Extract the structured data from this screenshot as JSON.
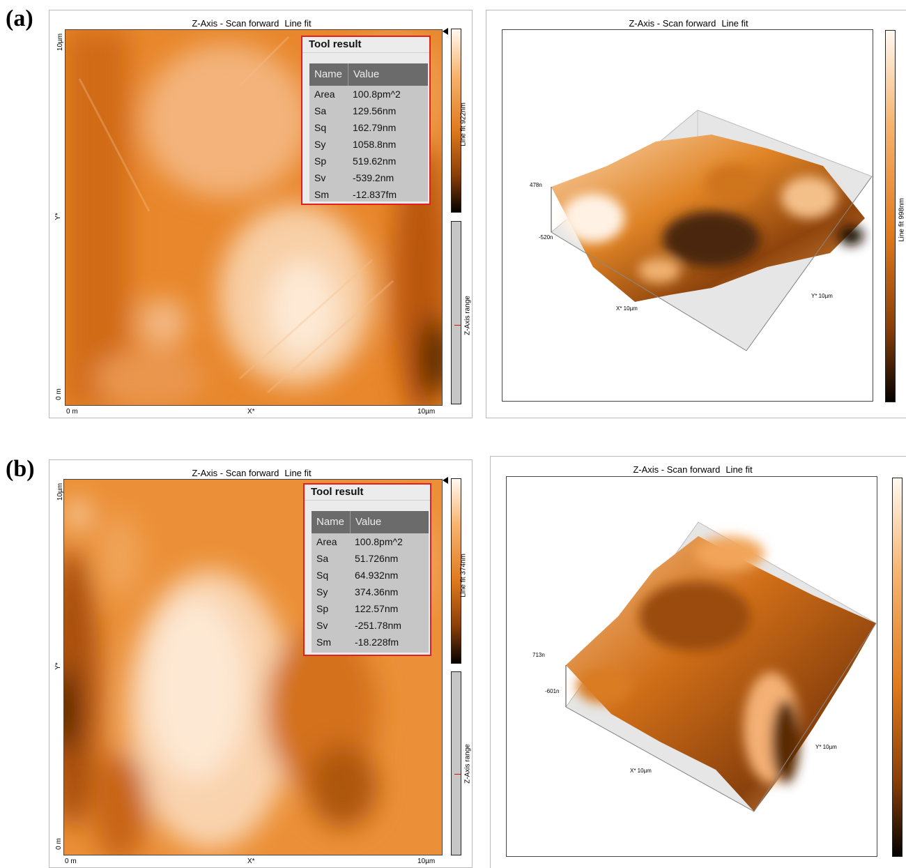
{
  "panels": [
    {
      "label": "(a)",
      "afm2d": {
        "title_main": "Z-Axis - Scan forward",
        "title_fit": "Line fit",
        "y_top": "10µm",
        "y_mid": "Y*",
        "y_bottom": "0 m",
        "x_left": "0 m",
        "x_mid": "X*",
        "x_right": "10µm",
        "colorbar_label": "Line fit 922nm",
        "range_label": "Z-Axis range"
      },
      "tool": {
        "title": "Tool result",
        "headers": [
          "Name",
          "Value"
        ],
        "rows": [
          [
            "Area",
            "100.8pm^2"
          ],
          [
            "Sa",
            "129.56nm"
          ],
          [
            "Sq",
            "162.79nm"
          ],
          [
            "Sy",
            "1058.8nm"
          ],
          [
            "Sp",
            "519.62nm"
          ],
          [
            "Sv",
            "-539.2nm"
          ],
          [
            "Sm",
            "-12.837fm"
          ]
        ]
      },
      "afm3d": {
        "title_main": "Z-Axis - Scan forward",
        "title_fit": "Line fit",
        "z_top": "478n",
        "z_bottom": "-520n",
        "x_axis": "X* 10µm",
        "y_axis": "Y* 10µm",
        "colorbar_label": "Line fit 998nm"
      }
    },
    {
      "label": "(b)",
      "afm2d": {
        "title_main": "Z-Axis - Scan forward",
        "title_fit": "Line fit",
        "y_top": "10µm",
        "y_mid": "Y*",
        "y_bottom": "0 m",
        "x_left": "0 m",
        "x_mid": "X*",
        "x_right": "10µm",
        "colorbar_label": "Line fit 374nm",
        "range_label": "Z-Axis range"
      },
      "tool": {
        "title": "Tool result",
        "headers": [
          "Name",
          "Value"
        ],
        "rows": [
          [
            "Area",
            "100.8pm^2"
          ],
          [
            "Sa",
            "51.726nm"
          ],
          [
            "Sq",
            "64.932nm"
          ],
          [
            "Sy",
            "374.36nm"
          ],
          [
            "Sp",
            "122.57nm"
          ],
          [
            "Sv",
            "-251.78nm"
          ],
          [
            "Sm",
            "-18.228fm"
          ]
        ]
      },
      "afm3d": {
        "title_main": "Z-Axis - Scan forward",
        "title_fit": "Line fit",
        "z_top": "713n",
        "z_bottom": "-601n",
        "x_axis": "X* 10µm",
        "y_axis": "Y* 10µm"
      }
    }
  ],
  "colors": {
    "orange": "#e8801f",
    "light": "#fbe3c8",
    "dark": "#3a1c05",
    "highlight_border": "#e02020"
  }
}
